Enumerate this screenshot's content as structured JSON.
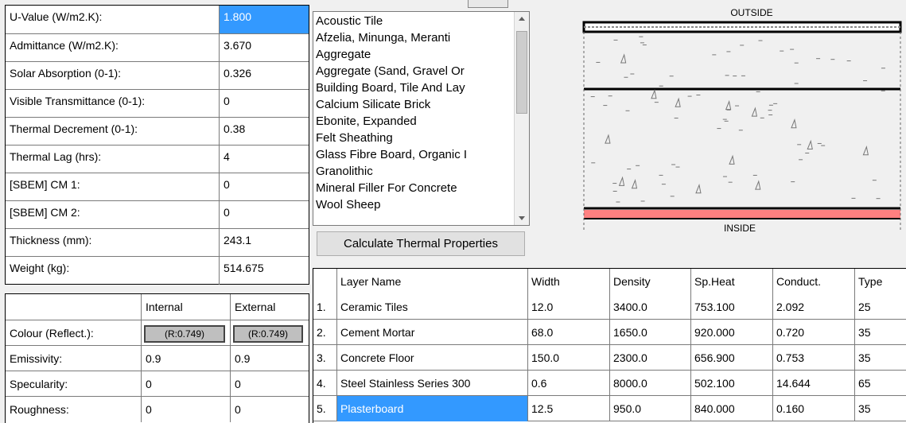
{
  "properties": [
    {
      "label": "U-Value (W/m2.K):",
      "value": "1.800",
      "selected": true
    },
    {
      "label": "Admittance (W/m2.K):",
      "value": "3.670"
    },
    {
      "label": "Solar Absorption (0-1):",
      "value": "0.326"
    },
    {
      "label": "Visible Transmittance (0-1):",
      "value": "0"
    },
    {
      "label": "Thermal Decrement (0-1):",
      "value": "0.38"
    },
    {
      "label": "Thermal Lag (hrs):",
      "value": "4"
    },
    {
      "label": "[SBEM] CM 1:",
      "value": "0"
    },
    {
      "label": "[SBEM] CM 2:",
      "value": "0"
    },
    {
      "label": "Thickness (mm):",
      "value": "243.1"
    },
    {
      "label": "Weight (kg):",
      "value": "514.675"
    }
  ],
  "surface": {
    "headers": [
      "",
      "Internal",
      "External"
    ],
    "rows": [
      {
        "label": "Colour (Reflect.):",
        "internal": "(R:0.749)",
        "external": "(R:0.749)",
        "swatch": true
      },
      {
        "label": "Emissivity:",
        "internal": "0.9",
        "external": "0.9"
      },
      {
        "label": "Specularity:",
        "internal": "0",
        "external": "0"
      },
      {
        "label": "Roughness:",
        "internal": "0",
        "external": "0"
      }
    ]
  },
  "materials": [
    "Acoustic Tile",
    "Afzelia, Minunga, Meranti",
    "Aggregate",
    "Aggregate (Sand, Gravel Or",
    "Building Board, Tile And Lay",
    "Calcium Silicate Brick",
    "Ebonite, Expanded",
    "Felt Sheathing",
    "Glass Fibre Board, Organic I",
    "Granolithic",
    "Mineral Filler For Concrete",
    "Wool Sheep"
  ],
  "calculate_button": "Calculate Thermal Properties",
  "diagram": {
    "outside_label": "OUTSIDE",
    "inside_label": "INSIDE",
    "inner_finish_color": "#ff8080"
  },
  "layers": {
    "headers": [
      "",
      "Layer Name",
      "Width",
      "Density",
      "Sp.Heat",
      "Conduct.",
      "Type"
    ],
    "rows": [
      {
        "n": "1.",
        "name": "Ceramic Tiles",
        "width": "12.0",
        "density": "3400.0",
        "spheat": "753.100",
        "conduct": "2.092",
        "type": "25"
      },
      {
        "n": "2.",
        "name": "Cement Mortar",
        "width": "68.0",
        "density": "1650.0",
        "spheat": "920.000",
        "conduct": "0.720",
        "type": "35"
      },
      {
        "n": "3.",
        "name": "Concrete Floor",
        "width": "150.0",
        "density": "2300.0",
        "spheat": "656.900",
        "conduct": "0.753",
        "type": "35"
      },
      {
        "n": "4.",
        "name": "Steel Stainless Series 300",
        "width": "0.6",
        "density": "8000.0",
        "spheat": "502.100",
        "conduct": "14.644",
        "type": "65"
      },
      {
        "n": "5.",
        "name": "Plasterboard",
        "width": "12.5",
        "density": "950.0",
        "spheat": "840.000",
        "conduct": "0.160",
        "type": "35",
        "selected": true
      }
    ]
  },
  "colors": {
    "selection": "#3399ff",
    "swatch": "#bfbfbf"
  }
}
